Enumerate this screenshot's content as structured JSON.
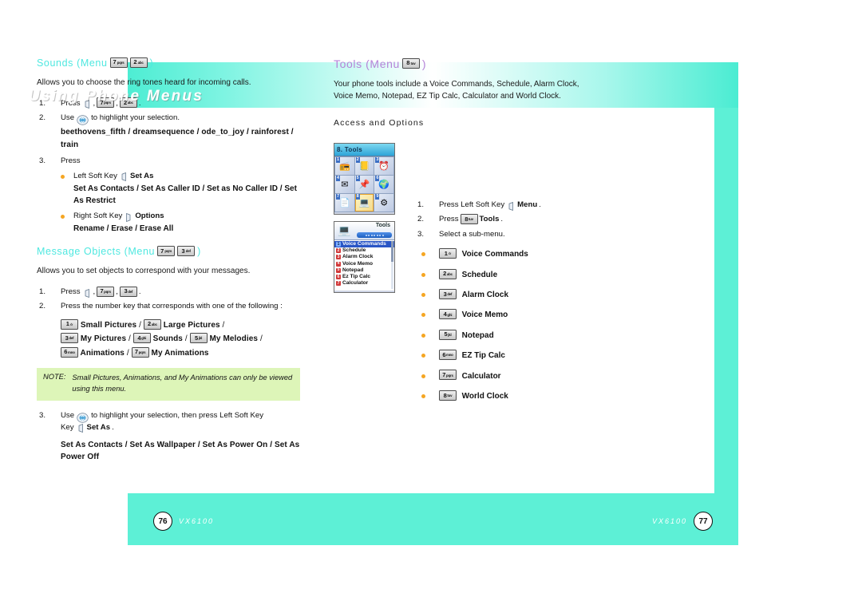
{
  "book": {
    "title": "Using Phone Menus",
    "left_footer": {
      "page": "76",
      "model": "VX6100"
    },
    "right_footer": {
      "page": "77",
      "model": "VX6100"
    }
  },
  "left_page": {
    "sections": [
      {
        "heading": "Sounds (Menu",
        "heading_close": ")",
        "keys": [
          {
            "digit": "7",
            "letters": "pqrs"
          },
          {
            "digit": "2",
            "letters": "abc"
          }
        ],
        "intro": "Allows you to choose the ring tones heard for incoming calls.",
        "steps": [
          {
            "num": "1.",
            "text_before": "Press",
            "icon": "soft-key-icon",
            "keys": [
              {
                "digit": "7",
                "letters": "pqrs"
              },
              {
                "digit": "2",
                "letters": "abc"
              }
            ],
            "text_after": "."
          },
          {
            "num": "2.",
            "text_before": "Use",
            "icon": "navigation-key-icon",
            "text_after": "to highlight your selection.",
            "bold_list": "beethovens_fifth / dreamsequence / ode_to_joy / rainforest / train"
          },
          {
            "num": "3.",
            "text_before": "Press",
            "bullets": [
              {
                "label": "Left Soft Key",
                "icon": "left-soft-key-icon",
                "bold": "Set As",
                "sub_bold": "Set As Contacts / Set As Caller ID / Set as No Caller ID / Set As Restrict"
              },
              {
                "label": "Right Soft Key",
                "icon": "right-soft-key-icon",
                "bold": "Options",
                "sub_bold": "Rename / Erase / Erase All"
              }
            ]
          }
        ]
      },
      {
        "heading": "Message Objects (Menu",
        "heading_close": ")",
        "keys": [
          {
            "digit": "7",
            "letters": "pqrs"
          },
          {
            "digit": "3",
            "letters": "def"
          }
        ],
        "intro": "Allows you to set objects to correspond with your messages.",
        "steps": [
          {
            "num": "1.",
            "text_before": "Press",
            "icon": "soft-key-icon",
            "keys": [
              {
                "digit": "7",
                "letters": "pqrs"
              },
              {
                "digit": "3",
                "letters": "def"
              }
            ],
            "text_after": "."
          },
          {
            "num": "2.",
            "text_before": "Press the number key that corresponds with one of the following :",
            "key_options": [
              {
                "digit": "1",
                "letters": "☉",
                "label": "Small Pictures"
              },
              {
                "digit": "2",
                "letters": "abc",
                "label": "Large Pictures"
              },
              {
                "digit": "3",
                "letters": "def",
                "label": "My Pictures"
              },
              {
                "digit": "4",
                "letters": "ghi",
                "label": "Sounds"
              },
              {
                "digit": "5",
                "letters": "jkl",
                "label": "My Melodies"
              },
              {
                "digit": "6",
                "letters": "mno",
                "label": "Animations"
              },
              {
                "digit": "7",
                "letters": "pqrs",
                "label": "My Animations"
              }
            ]
          }
        ],
        "note": {
          "label": "NOTE:",
          "text": "Small Pictures, Animations, and  My Animations can only be viewed using this menu."
        },
        "final_step": {
          "num": "3.",
          "text_before": "Use",
          "icon": "navigation-key-icon",
          "text_mid": "to highlight your selection, then press Left Soft Key",
          "softkey_icon": "left-soft-key-icon",
          "bold": "Set As",
          "text_after": ".",
          "bold_list": "Set As Contacts / Set As Wallpaper / Set As Power On / Set As Power Off"
        }
      }
    ]
  },
  "right_page": {
    "heading": "Tools (Menu",
    "heading_close": ")",
    "heading_key": {
      "digit": "8",
      "letters": "tuv"
    },
    "intro": "Your phone tools include a Voice Commands, Schedule, Alarm Clock, Voice Memo, Notepad, EZ Tip Calc, Calculator and World Clock.",
    "subheading": "Access and Options",
    "steps": [
      {
        "num": "1.",
        "text_before": "Press Left Soft Key",
        "icon": "left-soft-key-icon",
        "bold": "Menu",
        "text_after": "."
      },
      {
        "num": "2.",
        "text_before": "Press",
        "key": {
          "digit": "8",
          "letters": "tuv"
        },
        "bold": "Tools",
        "text_after": "."
      },
      {
        "num": "3.",
        "text_before": "Select a sub-menu."
      }
    ],
    "submenu": [
      {
        "key": {
          "digit": "1",
          "letters": "☉"
        },
        "label": "Voice Commands"
      },
      {
        "key": {
          "digit": "2",
          "letters": "abc"
        },
        "label": "Schedule"
      },
      {
        "key": {
          "digit": "3",
          "letters": "def"
        },
        "label": "Alarm Clock"
      },
      {
        "key": {
          "digit": "4",
          "letters": "ghi"
        },
        "label": "Voice Memo"
      },
      {
        "key": {
          "digit": "5",
          "letters": "jkl"
        },
        "label": "Notepad"
      },
      {
        "key": {
          "digit": "6",
          "letters": "mno"
        },
        "label": "EZ Tip Calc"
      },
      {
        "key": {
          "digit": "7",
          "letters": "pqrs"
        },
        "label": "Calculator"
      },
      {
        "key": {
          "digit": "8",
          "letters": "tuv"
        },
        "label": "World Clock"
      }
    ],
    "screenshot_menu_grid": {
      "title": "8. Tools",
      "cells": [
        {
          "n": "1",
          "glyph": "📻"
        },
        {
          "n": "2",
          "glyph": "📒"
        },
        {
          "n": "3",
          "glyph": "⏰"
        },
        {
          "n": "4",
          "glyph": "✉"
        },
        {
          "n": "5",
          "glyph": "📌"
        },
        {
          "n": "6",
          "glyph": "🌍"
        },
        {
          "n": "7",
          "glyph": "📄"
        },
        {
          "n": "8",
          "glyph": "💻",
          "selected": true
        },
        {
          "n": "9",
          "glyph": "⚙"
        }
      ]
    },
    "screenshot_tools_list": {
      "title": "Tools",
      "items": [
        {
          "n": "1",
          "label": "Voice Commands",
          "highlighted": true
        },
        {
          "n": "2",
          "label": "Schedule"
        },
        {
          "n": "3",
          "label": "Alarm Clock"
        },
        {
          "n": "4",
          "label": "Voice Memo"
        },
        {
          "n": "5",
          "label": "Notepad"
        },
        {
          "n": "6",
          "label": "Ez Tip Calc"
        },
        {
          "n": "7",
          "label": "Calculator"
        }
      ]
    }
  },
  "colors": {
    "teal": "#5df0d6",
    "cyan_heading": "#4fe8e0",
    "violet_heading": "#b583d8",
    "bullet_orange": "#f5a623",
    "note_bg": "#ddf5b8"
  }
}
